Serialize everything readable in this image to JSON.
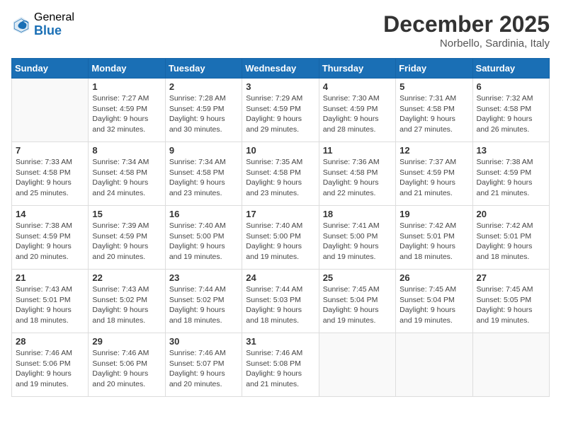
{
  "logo": {
    "general": "General",
    "blue": "Blue"
  },
  "title": "December 2025",
  "location": "Norbello, Sardinia, Italy",
  "days_of_week": [
    "Sunday",
    "Monday",
    "Tuesday",
    "Wednesday",
    "Thursday",
    "Friday",
    "Saturday"
  ],
  "weeks": [
    [
      {
        "day": "",
        "info": ""
      },
      {
        "day": "1",
        "info": "Sunrise: 7:27 AM\nSunset: 4:59 PM\nDaylight: 9 hours\nand 32 minutes."
      },
      {
        "day": "2",
        "info": "Sunrise: 7:28 AM\nSunset: 4:59 PM\nDaylight: 9 hours\nand 30 minutes."
      },
      {
        "day": "3",
        "info": "Sunrise: 7:29 AM\nSunset: 4:59 PM\nDaylight: 9 hours\nand 29 minutes."
      },
      {
        "day": "4",
        "info": "Sunrise: 7:30 AM\nSunset: 4:59 PM\nDaylight: 9 hours\nand 28 minutes."
      },
      {
        "day": "5",
        "info": "Sunrise: 7:31 AM\nSunset: 4:58 PM\nDaylight: 9 hours\nand 27 minutes."
      },
      {
        "day": "6",
        "info": "Sunrise: 7:32 AM\nSunset: 4:58 PM\nDaylight: 9 hours\nand 26 minutes."
      }
    ],
    [
      {
        "day": "7",
        "info": "Sunrise: 7:33 AM\nSunset: 4:58 PM\nDaylight: 9 hours\nand 25 minutes."
      },
      {
        "day": "8",
        "info": "Sunrise: 7:34 AM\nSunset: 4:58 PM\nDaylight: 9 hours\nand 24 minutes."
      },
      {
        "day": "9",
        "info": "Sunrise: 7:34 AM\nSunset: 4:58 PM\nDaylight: 9 hours\nand 23 minutes."
      },
      {
        "day": "10",
        "info": "Sunrise: 7:35 AM\nSunset: 4:58 PM\nDaylight: 9 hours\nand 23 minutes."
      },
      {
        "day": "11",
        "info": "Sunrise: 7:36 AM\nSunset: 4:58 PM\nDaylight: 9 hours\nand 22 minutes."
      },
      {
        "day": "12",
        "info": "Sunrise: 7:37 AM\nSunset: 4:59 PM\nDaylight: 9 hours\nand 21 minutes."
      },
      {
        "day": "13",
        "info": "Sunrise: 7:38 AM\nSunset: 4:59 PM\nDaylight: 9 hours\nand 21 minutes."
      }
    ],
    [
      {
        "day": "14",
        "info": "Sunrise: 7:38 AM\nSunset: 4:59 PM\nDaylight: 9 hours\nand 20 minutes."
      },
      {
        "day": "15",
        "info": "Sunrise: 7:39 AM\nSunset: 4:59 PM\nDaylight: 9 hours\nand 20 minutes."
      },
      {
        "day": "16",
        "info": "Sunrise: 7:40 AM\nSunset: 5:00 PM\nDaylight: 9 hours\nand 19 minutes."
      },
      {
        "day": "17",
        "info": "Sunrise: 7:40 AM\nSunset: 5:00 PM\nDaylight: 9 hours\nand 19 minutes."
      },
      {
        "day": "18",
        "info": "Sunrise: 7:41 AM\nSunset: 5:00 PM\nDaylight: 9 hours\nand 19 minutes."
      },
      {
        "day": "19",
        "info": "Sunrise: 7:42 AM\nSunset: 5:01 PM\nDaylight: 9 hours\nand 18 minutes."
      },
      {
        "day": "20",
        "info": "Sunrise: 7:42 AM\nSunset: 5:01 PM\nDaylight: 9 hours\nand 18 minutes."
      }
    ],
    [
      {
        "day": "21",
        "info": "Sunrise: 7:43 AM\nSunset: 5:01 PM\nDaylight: 9 hours\nand 18 minutes."
      },
      {
        "day": "22",
        "info": "Sunrise: 7:43 AM\nSunset: 5:02 PM\nDaylight: 9 hours\nand 18 minutes."
      },
      {
        "day": "23",
        "info": "Sunrise: 7:44 AM\nSunset: 5:02 PM\nDaylight: 9 hours\nand 18 minutes."
      },
      {
        "day": "24",
        "info": "Sunrise: 7:44 AM\nSunset: 5:03 PM\nDaylight: 9 hours\nand 18 minutes."
      },
      {
        "day": "25",
        "info": "Sunrise: 7:45 AM\nSunset: 5:04 PM\nDaylight: 9 hours\nand 19 minutes."
      },
      {
        "day": "26",
        "info": "Sunrise: 7:45 AM\nSunset: 5:04 PM\nDaylight: 9 hours\nand 19 minutes."
      },
      {
        "day": "27",
        "info": "Sunrise: 7:45 AM\nSunset: 5:05 PM\nDaylight: 9 hours\nand 19 minutes."
      }
    ],
    [
      {
        "day": "28",
        "info": "Sunrise: 7:46 AM\nSunset: 5:06 PM\nDaylight: 9 hours\nand 19 minutes."
      },
      {
        "day": "29",
        "info": "Sunrise: 7:46 AM\nSunset: 5:06 PM\nDaylight: 9 hours\nand 20 minutes."
      },
      {
        "day": "30",
        "info": "Sunrise: 7:46 AM\nSunset: 5:07 PM\nDaylight: 9 hours\nand 20 minutes."
      },
      {
        "day": "31",
        "info": "Sunrise: 7:46 AM\nSunset: 5:08 PM\nDaylight: 9 hours\nand 21 minutes."
      },
      {
        "day": "",
        "info": ""
      },
      {
        "day": "",
        "info": ""
      },
      {
        "day": "",
        "info": ""
      }
    ]
  ]
}
